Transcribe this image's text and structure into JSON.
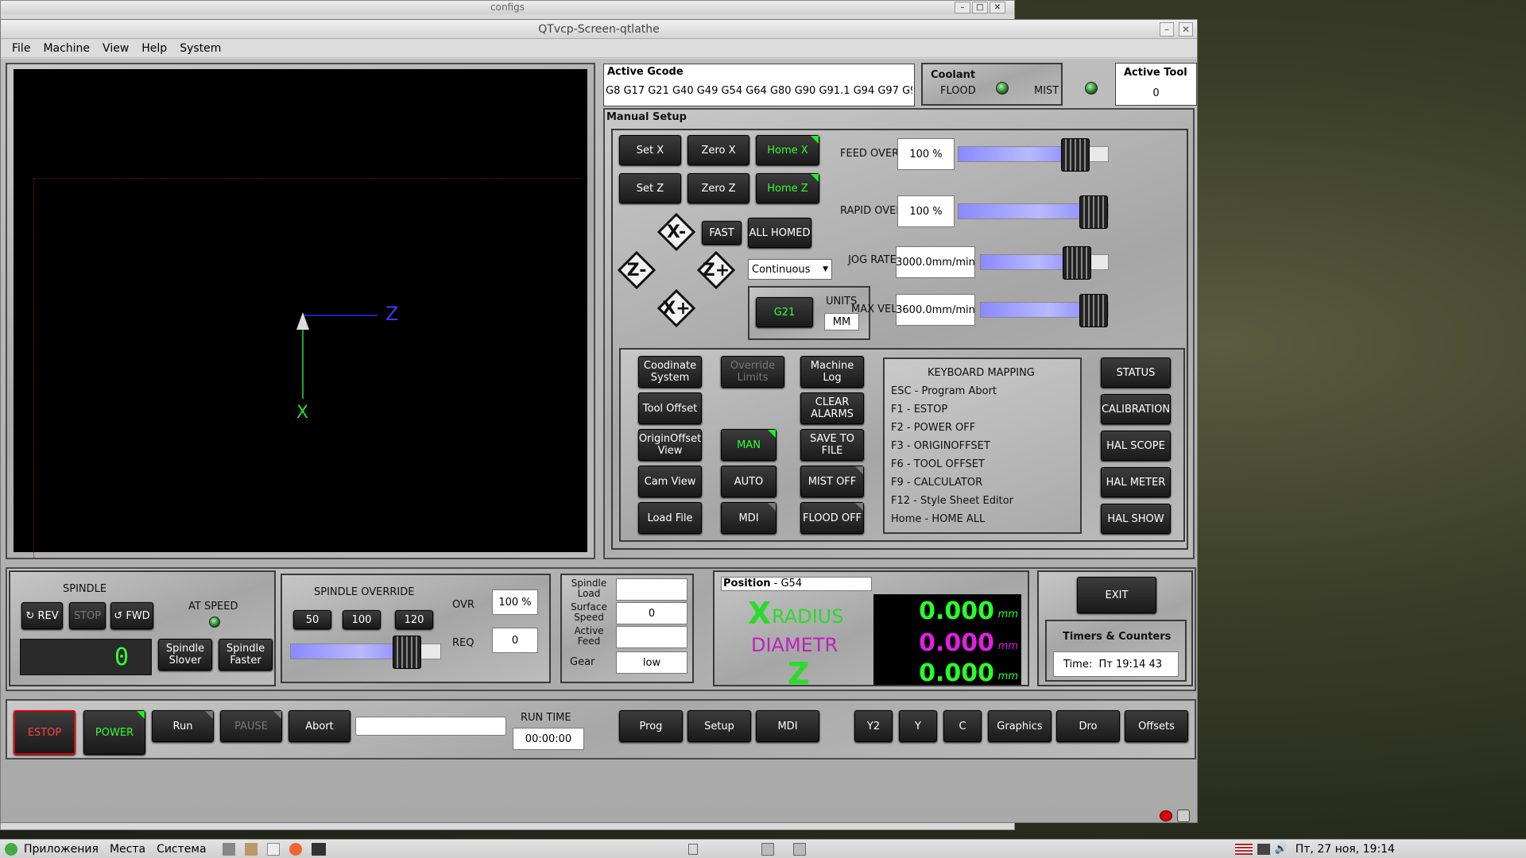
{
  "bg_window": {
    "title": "configs"
  },
  "window": {
    "title": "QTvcp-Screen-qtlathe"
  },
  "menu": [
    "File",
    "Machine",
    "View",
    "Help",
    "System"
  ],
  "preview": {
    "axis_z": "Z",
    "axis_x": "X"
  },
  "gcode": {
    "title": "Active Gcode",
    "codes": "G8 G17 G21 G40 G49 G54 G64 G80 G90 G91.1 G94 G97 G9"
  },
  "coolant": {
    "title": "Coolant",
    "flood": "FLOOD",
    "mist": "MIST"
  },
  "tool": {
    "title": "Active Tool",
    "value": "0"
  },
  "manual": {
    "title": "Manual Setup",
    "set_x": "Set X",
    "zero_x": "Zero X",
    "home_x": "Home X",
    "set_z": "Set Z",
    "zero_z": "Zero Z",
    "home_z": "Home Z",
    "fast": "FAST",
    "all_homed": "ALL HOMED",
    "jog_mode": "Continuous",
    "g21": "G21",
    "units": "UNITS",
    "mm": "MM",
    "jog_xm": "X-",
    "jog_xp": "X+",
    "jog_zm": "Z-",
    "jog_zp": "Z+"
  },
  "overrides": [
    {
      "label": "FEED OVERRIDE",
      "value": "100 %",
      "level": 0.85
    },
    {
      "label": "RAPID OVERRIDE",
      "value": "100 %",
      "level": 1.0
    },
    {
      "label": "JOG RATE",
      "value": "3000.0mm/min",
      "level": 0.83
    },
    {
      "label": "MAX VEL",
      "value": "3600.0mm/min",
      "level": 1.0
    }
  ],
  "buttons": {
    "coord": "Coodinate System",
    "override_limits": "Override Limits",
    "machine_log": "Machine Log",
    "tool_offset": "Tool Offset",
    "clear_alarms": "CLEAR ALARMS",
    "origin_offset": "OriginOffset View",
    "man": "MAN",
    "save_file": "SAVE TO FILE",
    "cam_view": "Cam View",
    "auto": "AUTO",
    "mist_off": "MIST OFF",
    "load_file": "Load File",
    "mdi": "MDI",
    "flood_off": "FLOOD OFF",
    "status": "STATUS",
    "calibration": "CALIBRATION",
    "hal_scope": "HAL SCOPE",
    "hal_meter": "HAL METER",
    "hal_show": "HAL SHOW"
  },
  "keymap": {
    "title": "KEYBOARD MAPPING",
    "items": [
      "ESC - Program Abort",
      "F1 - ESTOP",
      "F2 - POWER OFF",
      "F3 - ORIGINOFFSET",
      "F6 - TOOL OFFSET",
      "F9 - CALCULATOR",
      "F12 - Style Sheet Editor",
      "Home - HOME ALL"
    ]
  },
  "spindle": {
    "title": "SPINDLE",
    "rev": "REV",
    "stop": "STOP",
    "fwd": "FWD",
    "at_speed": "AT SPEED",
    "slower": "Spindle Slover",
    "faster": "Spindle Faster",
    "display": "0"
  },
  "spindle_ovr": {
    "title": "SPINDLE OVERRIDE",
    "b50": "50",
    "b100": "100",
    "b120": "120",
    "ovr": "OVR",
    "ovr_val": "100 %",
    "req": "REQ",
    "req_val": "0",
    "level": 0.84
  },
  "spindle_info": {
    "load": "Spindle Load",
    "surface": "Surface Speed",
    "surface_val": "0",
    "feed": "Active Feed",
    "gear": "Gear",
    "gear_val": "low"
  },
  "position": {
    "title": "Position",
    "coord": " - G54",
    "x": "X",
    "xlabel": "RADIUS",
    "dia": "DIAMETR",
    "z": "Z",
    "v1": "0.000",
    "v2": "0.000",
    "v3": "0.000",
    "unit": "mm"
  },
  "exit": "EXIT",
  "timers": {
    "title": "Timers & Counters",
    "time_label": "Time:",
    "time": "Пт 19:14 43"
  },
  "bottom": {
    "estop": "ESTOP",
    "power": "POWER",
    "run": "Run",
    "pause": "PAUSE",
    "abort": "Abort",
    "runtime": "RUN TIME",
    "runtime_val": "00:00:00",
    "prog": "Prog",
    "setup": "Setup",
    "mdi": "MDI",
    "y2": "Y2",
    "y": "Y",
    "c": "C",
    "graphics": "Graphics",
    "dro": "Dro",
    "offsets": "Offsets"
  },
  "taskbar": {
    "apps": "Приложения",
    "places": "Места",
    "system": "Система",
    "clock": "Пт, 27 ноя, 19:14"
  }
}
